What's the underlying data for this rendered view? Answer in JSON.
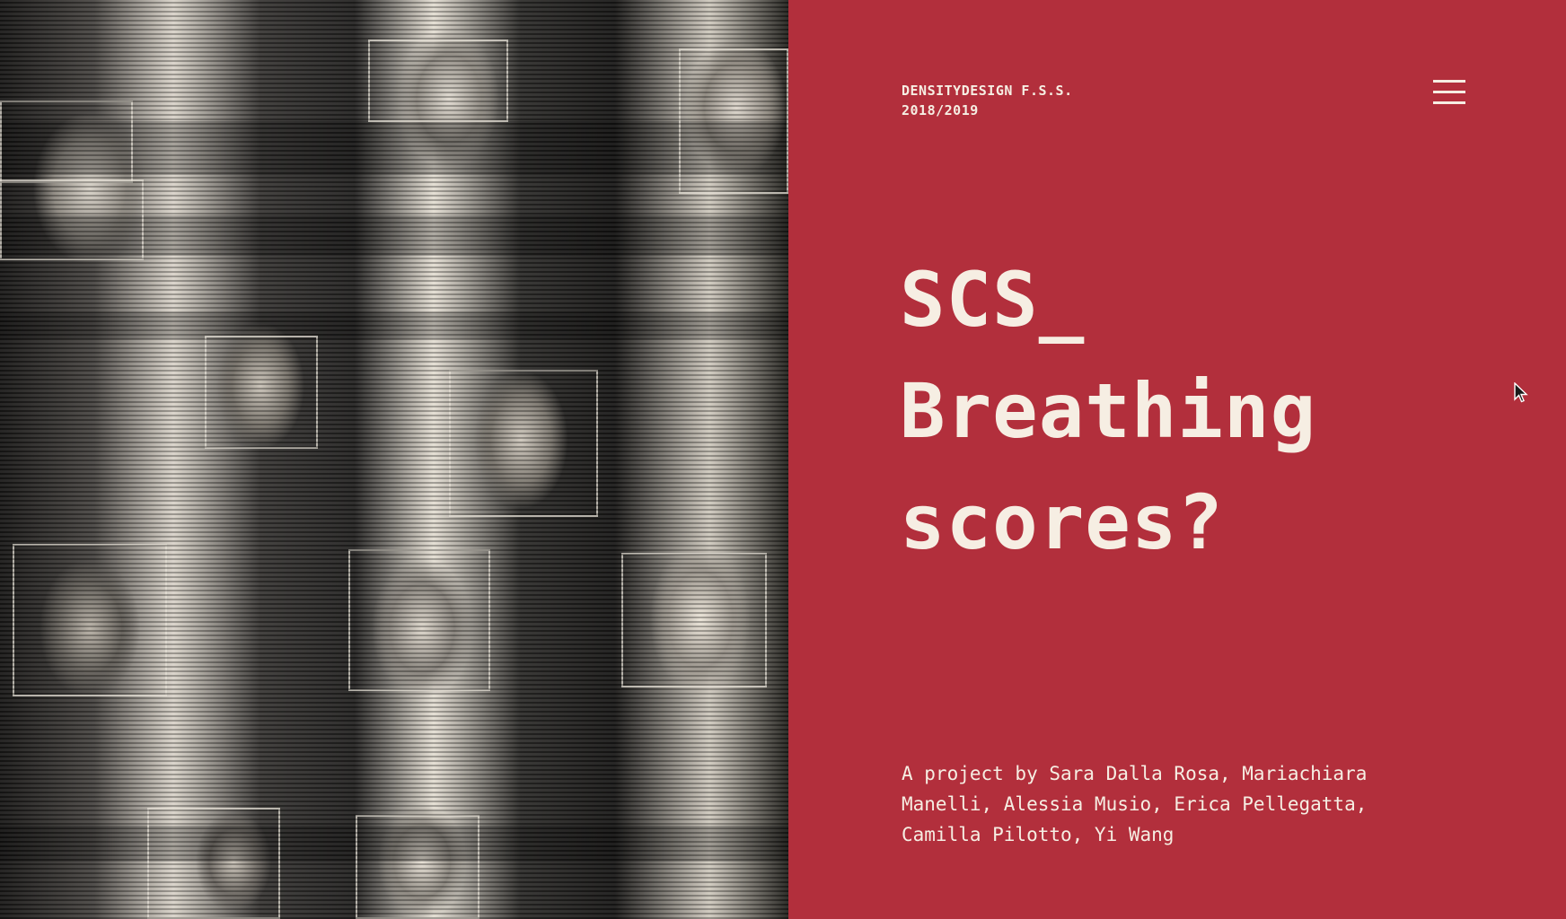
{
  "header": {
    "brand_line_1": "DENSITYDESIGN F.S.S.",
    "brand_line_2": "2018/2019",
    "menu_icon": "hamburger-menu-icon"
  },
  "hero": {
    "title_line_1": "SCS_",
    "title_line_2": "Breathing",
    "title_line_3": "scores?",
    "credits": "A project by Sara Dalla Rosa, Mariachiara Manelli, Alessia Musio, Erica Pellegatta, Camilla Pilotto, Yi Wang"
  },
  "colors": {
    "panel_red": "#b22f3c",
    "text_cream": "#f6eee3"
  }
}
